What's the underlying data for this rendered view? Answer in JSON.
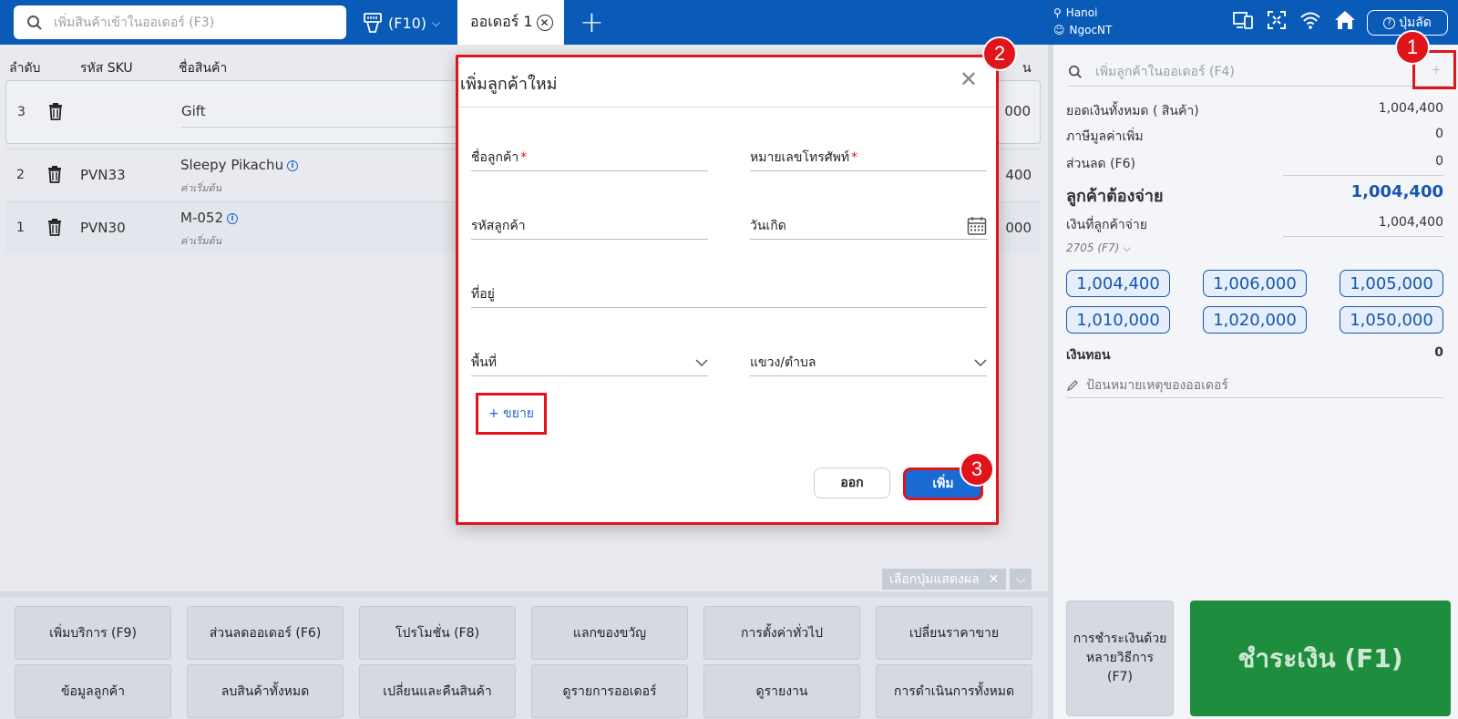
{
  "topbar": {
    "search_placeholder": "เพิ่มสินค้าเข้าในออเดอร์ (F3)",
    "f10_label": "(F10)",
    "tab_label": "ออเดอร์ 1",
    "location": "Hanoi",
    "user": "NgocNT",
    "help_label": "ปุ่มลัด"
  },
  "table": {
    "headers": {
      "index": "ลำดับ",
      "sku": "รหัส SKU",
      "name": "ชื่อสินค้า",
      "amount_tail": "น"
    },
    "rows": [
      {
        "num": "3",
        "sku": "",
        "name": "Gift",
        "sub": "",
        "amount": "000"
      },
      {
        "num": "2",
        "sku": "PVN33",
        "name": "Sleepy Pikachu",
        "sub": "ค่าเริ่มต้น",
        "amount": "400"
      },
      {
        "num": "1",
        "sku": "PVN30",
        "name": "M-052",
        "sub": "ค่าเริ่มต้น",
        "amount": "000"
      }
    ]
  },
  "display_select": "เลือกปุ่มแสดงผล",
  "actions": [
    "เพิ่มบริการ (F9)",
    "ส่วนลดออเดอร์ (F6)",
    "โปรโมชั่น (F8)",
    "แลกของขวัญ",
    "การตั้งค่าทั่วไป",
    "เปลี่ยนราคาขาย",
    "ข้อมูลลูกค้า",
    "ลบสินค้าทั้งหมด",
    "เปลี่ยนและคืนสินค้า",
    "ดูรายการออเดอร์",
    "ดูรายงาน",
    "การดำเนินการทั้งหมด"
  ],
  "right": {
    "customer_search_placeholder": "เพิ่มลูกค้าในออเดอร์ (F4)",
    "total_label": "ยอดเงินทั้งหมด ( สินค้า)",
    "total_value": "1,004,400",
    "vat_label": "ภาษีมูลค่าเพิ่ม",
    "vat_value": "0",
    "discount_label": "ส่วนลด (F6)",
    "discount_value": "0",
    "payable_label": "ลูกค้าต้องจ่าย",
    "payable_value": "1,004,400",
    "paid_label": "เงินที่ลูกค้าจ่าย",
    "paid_value": "1,004,400",
    "method_label": "2705 (F7)",
    "cash_buttons": [
      "1,004,400",
      "1,006,000",
      "1,005,000",
      "1,010,000",
      "1,020,000",
      "1,050,000"
    ],
    "change_label": "เงินทอน",
    "change_value": "0",
    "note_placeholder": "ป้อนหมายเหตุของออเดอร์",
    "multi_pay_label": "การชำระเงินด้วยหลายวิธีการ (F7)",
    "pay_label": "ชำระเงิน (F1)"
  },
  "modal": {
    "title": "เพิ่มลูกค้าใหม่",
    "name_label": "ชื่อลูกค้า",
    "phone_label": "หมายเลขโทรศัพท์",
    "code_label": "รหัสลูกค้า",
    "birthday_label": "วันเกิด",
    "address_label": "ที่อยู่",
    "area_label": "พื้นที่",
    "ward_label": "แขวง/ตำบล",
    "expand_label": "+ ขยาย",
    "exit_label": "ออก",
    "add_label": "เพิ่ม",
    "required_mark": "*"
  },
  "badges": [
    "1",
    "2",
    "3"
  ],
  "colors": {
    "brand": "#0a5bb8",
    "highlight": "#e0141b",
    "pay": "#1e8e3e"
  }
}
